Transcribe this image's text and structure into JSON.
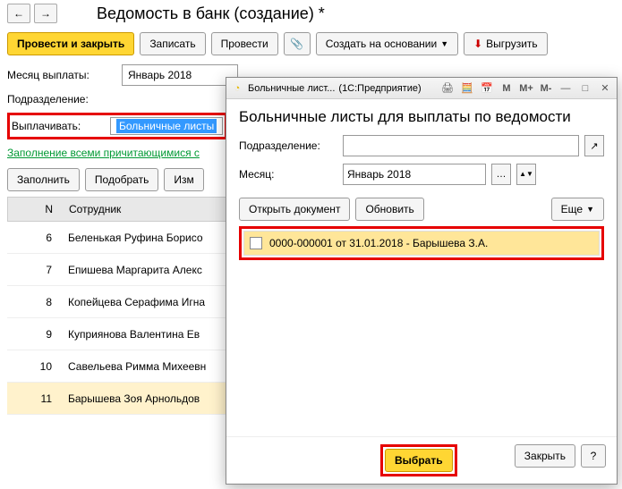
{
  "page": {
    "title": "Ведомость в банк (создание) *"
  },
  "toolbar": {
    "post_close": "Провести и закрыть",
    "save": "Записать",
    "post": "Провести",
    "create_based": "Создать на основании",
    "export": "Выгрузить"
  },
  "form": {
    "month_label": "Месяц выплаты:",
    "month_value": "Январь 2018",
    "division_label": "Подразделение:",
    "pay_label": "Выплачивать:",
    "pay_value": "Больничные листы",
    "fill_link": "Заполнение всеми причитающимися с"
  },
  "sub_toolbar": {
    "fill": "Заполнить",
    "select": "Подобрать",
    "edit": "Изм"
  },
  "grid": {
    "col_n": "N",
    "col_employee": "Сотрудник",
    "rows": [
      {
        "n": "6",
        "name": "Беленькая Руфина Борисо"
      },
      {
        "n": "7",
        "name": "Епишева Маргарита Алекс"
      },
      {
        "n": "8",
        "name": "Копейцева Серафима Игна"
      },
      {
        "n": "9",
        "name": "Куприянова Валентина Ев"
      },
      {
        "n": "10",
        "name": "Савельева Римма Михеевн"
      },
      {
        "n": "11",
        "name": "Барышева Зоя Арнольдов"
      }
    ]
  },
  "modal": {
    "titlebar_text": "Больничные лист...",
    "titlebar_app": "(1С:Предприятие)",
    "heading": "Больничные листы для выплаты по ведомости",
    "division_label": "Подразделение:",
    "month_label": "Месяц:",
    "month_value": "Январь 2018",
    "open_doc": "Открыть документ",
    "refresh": "Обновить",
    "more": "Еще",
    "list_item": "0000-000001 от 31.01.2018 - Барышева З.А.",
    "choose": "Выбрать",
    "close": "Закрыть",
    "help": "?",
    "m_buttons": {
      "m": "M",
      "m_plus": "M+",
      "m_minus": "M-"
    }
  }
}
